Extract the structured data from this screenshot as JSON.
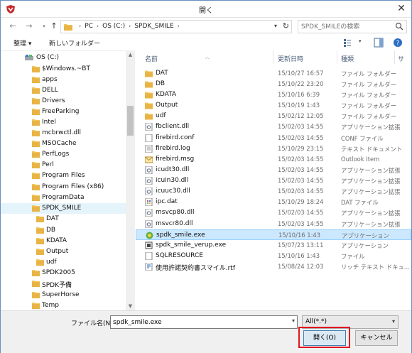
{
  "window": {
    "title": "開く"
  },
  "address": {
    "crumbs": [
      "PC",
      "OS (C:)",
      "SPDK_SMILE"
    ]
  },
  "search": {
    "placeholder": "SPDK_SMILEの検索"
  },
  "toolbar": {
    "organize": "整理 ▾",
    "new_folder": "新しいフォルダー"
  },
  "nav": {
    "items": [
      {
        "label": "OS (C:)",
        "icon": "drive-icon"
      },
      {
        "label": "$Windows.~BT",
        "icon": "folder-icon"
      },
      {
        "label": "apps",
        "icon": "folder-icon"
      },
      {
        "label": "DELL",
        "icon": "folder-icon"
      },
      {
        "label": "Drivers",
        "icon": "folder-icon"
      },
      {
        "label": "FreeParking",
        "icon": "folder-icon"
      },
      {
        "label": "Intel",
        "icon": "folder-icon"
      },
      {
        "label": "mcbrwctl.dll",
        "icon": "folder-icon"
      },
      {
        "label": "MSOCache",
        "icon": "folder-icon"
      },
      {
        "label": "PerfLogs",
        "icon": "folder-icon"
      },
      {
        "label": "Perl",
        "icon": "folder-icon"
      },
      {
        "label": "Program Files",
        "icon": "folder-icon"
      },
      {
        "label": "Program Files (x86)",
        "icon": "folder-icon"
      },
      {
        "label": "ProgramData",
        "icon": "folder-icon"
      },
      {
        "label": "SPDK_SMILE",
        "icon": "folder-icon"
      },
      {
        "label": "DAT",
        "icon": "folder-icon"
      },
      {
        "label": "DB",
        "icon": "folder-icon"
      },
      {
        "label": "KDATA",
        "icon": "folder-icon"
      },
      {
        "label": "Output",
        "icon": "folder-icon"
      },
      {
        "label": "udf",
        "icon": "folder-icon"
      },
      {
        "label": "SPDK2005",
        "icon": "folder-icon"
      },
      {
        "label": "SPDK予備",
        "icon": "folder-icon"
      },
      {
        "label": "SuperHorse",
        "icon": "folder-icon"
      },
      {
        "label": "Temp",
        "icon": "folder-icon"
      }
    ]
  },
  "files": {
    "columns": {
      "name": "名前",
      "date": "更新日時",
      "type": "種類",
      "size": "サ"
    },
    "rows": [
      {
        "name": "DAT",
        "date": "15/10/27 16:57",
        "type": "ファイル フォルダー",
        "icon": "folder-icon"
      },
      {
        "name": "DB",
        "date": "15/10/22 23:20",
        "type": "ファイル フォルダー",
        "icon": "folder-icon"
      },
      {
        "name": "KDATA",
        "date": "15/10/16 6:39",
        "type": "ファイル フォルダー",
        "icon": "folder-icon"
      },
      {
        "name": "Output",
        "date": "15/10/19 1:43",
        "type": "ファイル フォルダー",
        "icon": "folder-icon"
      },
      {
        "name": "udf",
        "date": "15/02/12 12:05",
        "type": "ファイル フォルダー",
        "icon": "folder-icon"
      },
      {
        "name": "fbclient.dll",
        "date": "15/02/03 14:55",
        "type": "アプリケーション拡張",
        "icon": "dll-icon"
      },
      {
        "name": "firebird.conf",
        "date": "15/02/03 14:55",
        "type": "CONF ファイル",
        "icon": "file-icon"
      },
      {
        "name": "firebird.log",
        "date": "15/10/29 23:15",
        "type": "テキスト ドキュメント",
        "icon": "text-file-icon"
      },
      {
        "name": "firebird.msg",
        "date": "15/02/03 14:55",
        "type": "Outlook Item",
        "icon": "mail-file-icon"
      },
      {
        "name": "icudt30.dll",
        "date": "15/02/03 14:55",
        "type": "アプリケーション拡張",
        "icon": "dll-icon"
      },
      {
        "name": "icuin30.dll",
        "date": "15/02/03 14:55",
        "type": "アプリケーション拡張",
        "icon": "dll-icon"
      },
      {
        "name": "icuuc30.dll",
        "date": "15/02/03 14:55",
        "type": "アプリケーション拡張",
        "icon": "dll-icon"
      },
      {
        "name": "ipc.dat",
        "date": "15/10/29 18:24",
        "type": "DAT ファイル",
        "icon": "dat-file-icon"
      },
      {
        "name": "msvcp80.dll",
        "date": "15/02/03 14:55",
        "type": "アプリケーション拡張",
        "icon": "dll-icon"
      },
      {
        "name": "msvcr80.dll",
        "date": "15/02/03 14:55",
        "type": "アプリケーション拡張",
        "icon": "dll-icon"
      },
      {
        "name": "spdk_smile.exe",
        "date": "15/10/16 1:43",
        "type": "アプリケーション",
        "icon": "app-exe-icon"
      },
      {
        "name": "spdk_smile_verup.exe",
        "date": "15/07/23 13:11",
        "type": "アプリケーション",
        "icon": "installer-exe-icon"
      },
      {
        "name": "SQLRESOURCE",
        "date": "15/10/16 1:43",
        "type": "ファイル",
        "icon": "file-icon"
      },
      {
        "name": "使用許諾契約書スマイル.rtf",
        "date": "15/08/24 12:03",
        "type": "リッチ テキスト ドキュ...",
        "icon": "rtf-file-icon"
      }
    ]
  },
  "bottom": {
    "filename_label": "ファイル名(N):",
    "filename_value": "spdk_smile.exe",
    "filetype_value": "All(*.*)",
    "open_label": "開く(O)",
    "cancel_label": "キャンセル"
  },
  "colors": {
    "selection": "#cce8ff",
    "folder": "#f2c55c",
    "highlight": "#e0141e"
  }
}
